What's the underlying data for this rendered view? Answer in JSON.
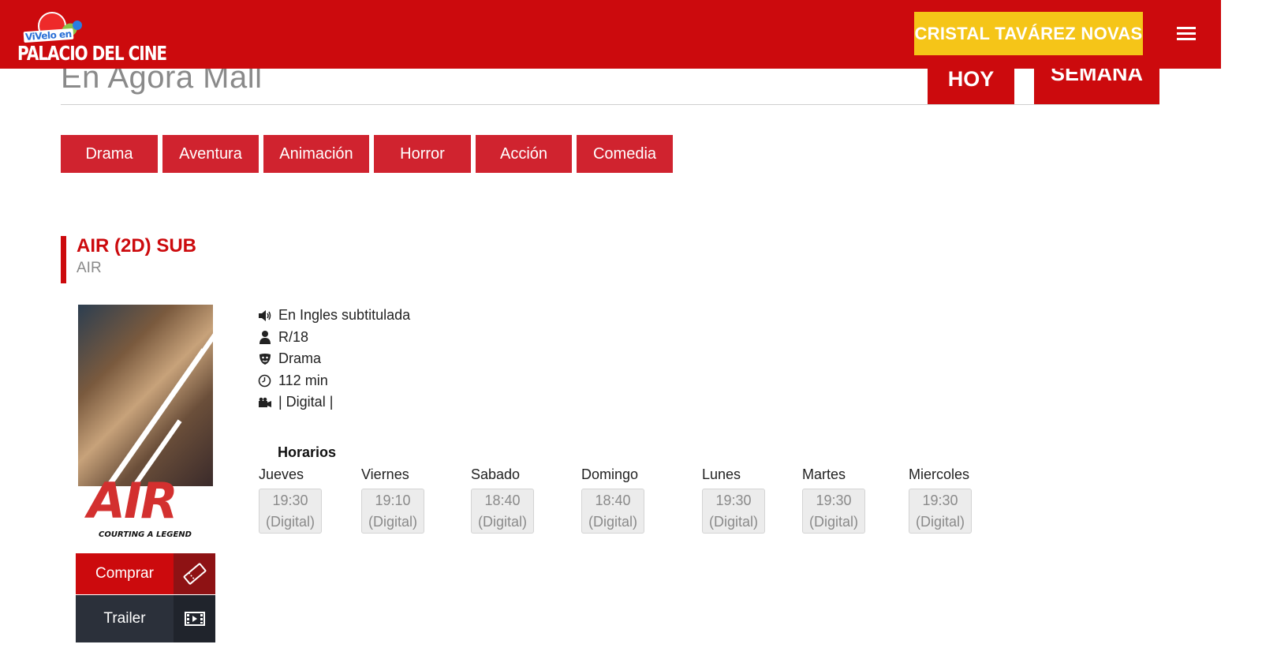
{
  "header": {
    "logo_top_text": "ViVelo en",
    "logo_bottom_text": "PALACIO DEL CINE",
    "user_name": "CRISTAL TAVÁREZ NOVAS",
    "menu_icon": "hamburger-icon"
  },
  "search": {
    "location_text": "En Agora Mall",
    "tab_today": "HOY",
    "tab_week": "SEMANA"
  },
  "genres": [
    "Drama",
    "Aventura",
    "Animación",
    "Horror",
    "Acción",
    "Comedia"
  ],
  "movie": {
    "title": "AIR (2D) SUB",
    "original_title": "AIR",
    "poster_title": "AIR",
    "poster_tagline": "COURTING A LEGEND",
    "language": "En Ingles subtitulada",
    "rating": "R/18",
    "genre": "Drama",
    "duration": "112 min",
    "format": "| Digital |",
    "buy_label": "Comprar",
    "trailer_label": "Trailer"
  },
  "schedule": {
    "title": "Horarios",
    "days": [
      {
        "day": "Jueves",
        "time": "19:30",
        "format": "(Digital)"
      },
      {
        "day": "Viernes",
        "time": "19:10",
        "format": "(Digital)"
      },
      {
        "day": "Sabado",
        "time": "18:40",
        "format": "(Digital)"
      },
      {
        "day": "Domingo",
        "time": "18:40",
        "format": "(Digital)"
      },
      {
        "day": "Lunes",
        "time": "19:30",
        "format": "(Digital)"
      },
      {
        "day": "Martes",
        "time": "19:30",
        "format": "(Digital)"
      },
      {
        "day": "Miercoles",
        "time": "19:30",
        "format": "(Digital)"
      }
    ]
  },
  "colors": {
    "brand_red": "#cc0a0d",
    "user_button": "#f5c518",
    "genre_red": "#d0232f",
    "trailer_dark": "#2b303a"
  }
}
